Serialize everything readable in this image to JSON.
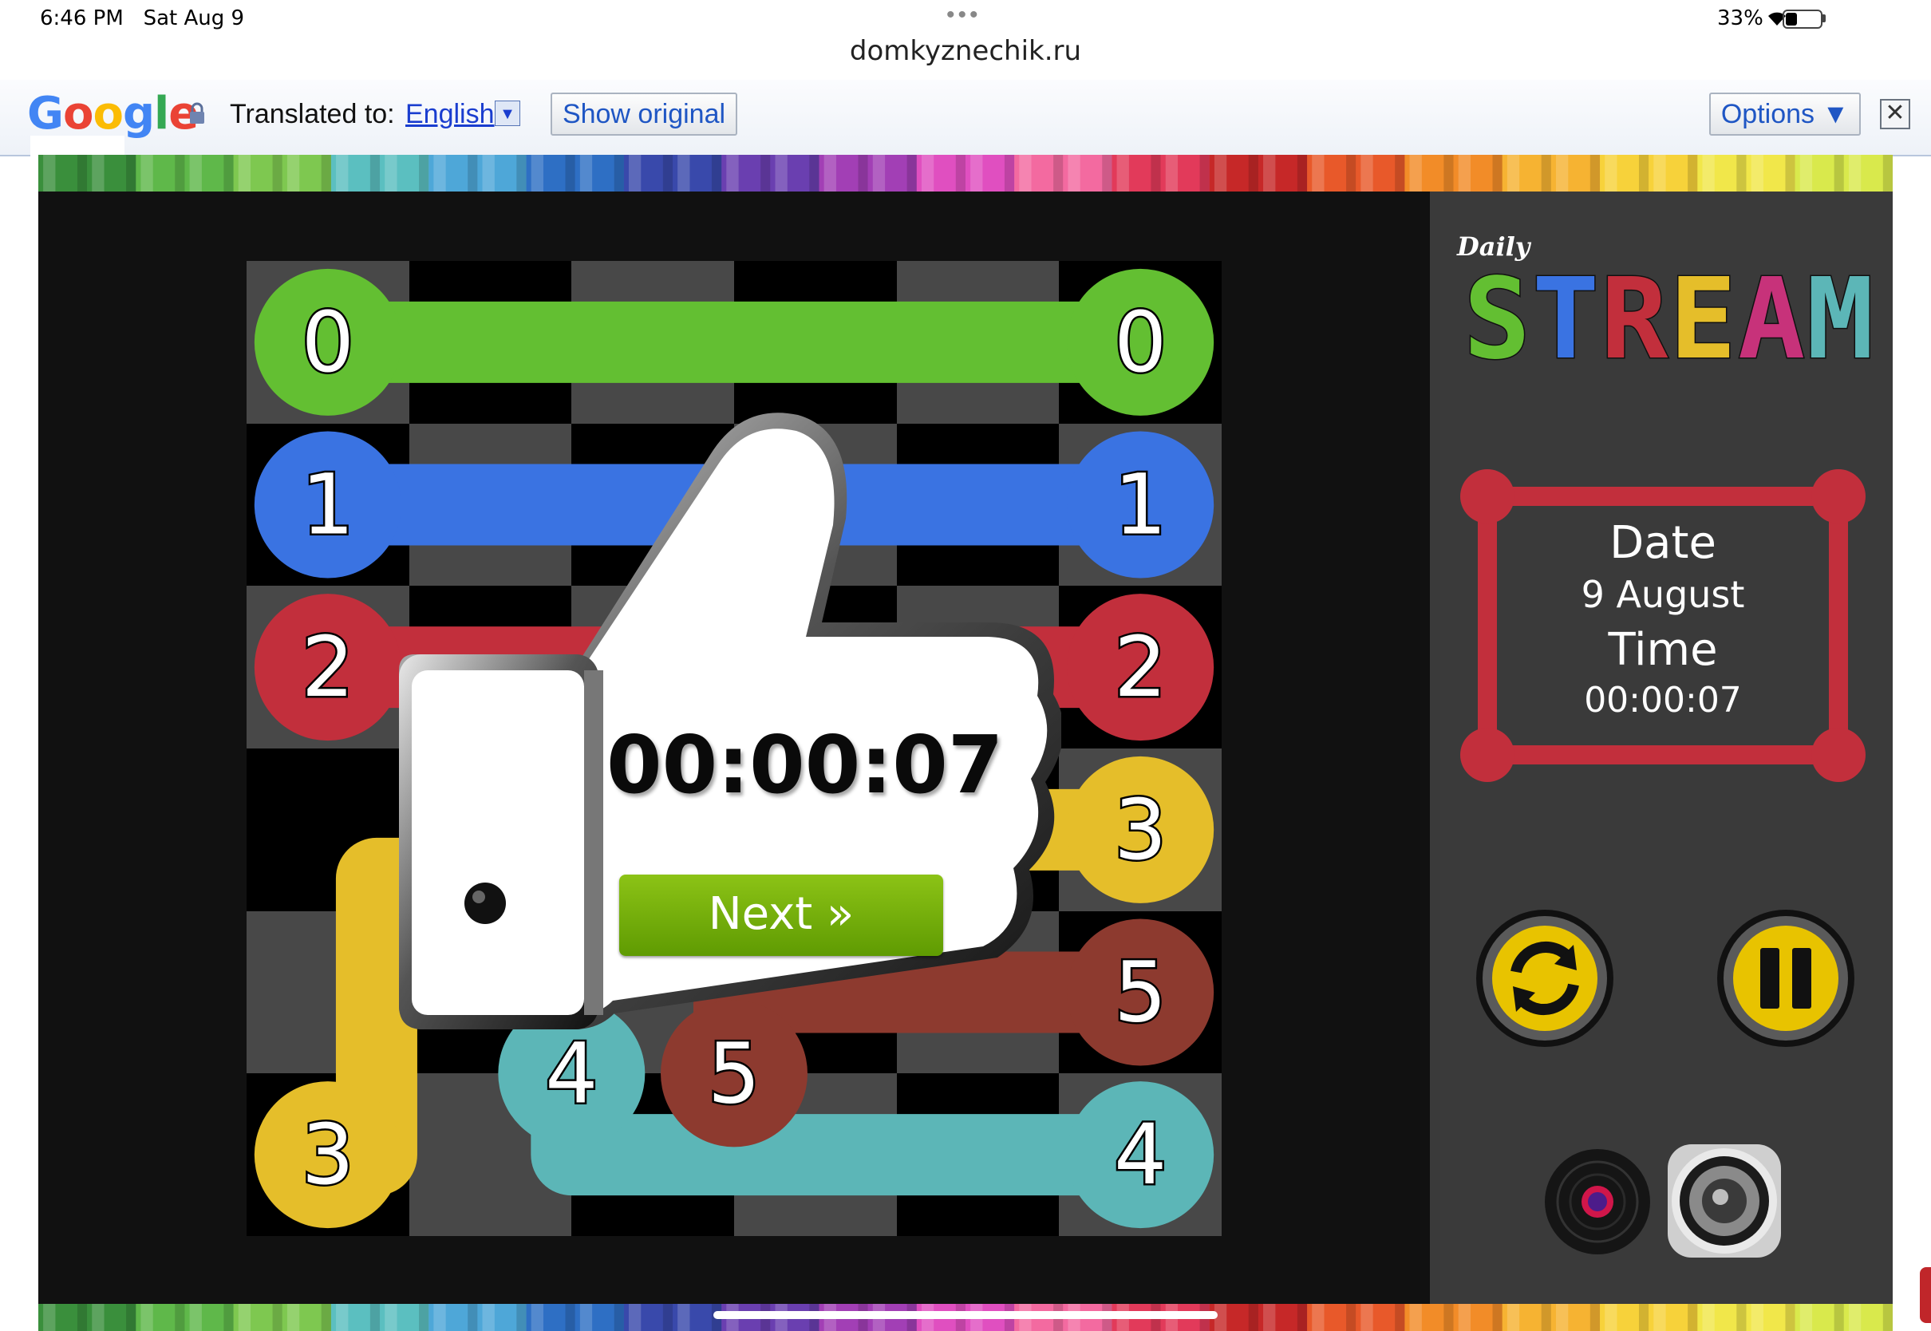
{
  "status_bar": {
    "time": "6:46 PM",
    "date": "Sat Aug 9",
    "battery_pct": "33%",
    "battery_level": 0.33,
    "url": "domkyznechik.ru"
  },
  "translate_bar": {
    "logo": "Google",
    "translated_to_label": "Translated to:",
    "language": "English",
    "dropdown_glyph": "▼",
    "show_original": "Show original",
    "options": "Options ▼",
    "close_glyph": "✕"
  },
  "board": {
    "rows": 6,
    "cols": 6,
    "light_cell_color": "#484848",
    "dark_cell_color": "#000000",
    "flows": [
      {
        "number": "0",
        "color": "#63bf32"
      },
      {
        "number": "1",
        "color": "#3a73e2"
      },
      {
        "number": "2",
        "color": "#c22f3c"
      },
      {
        "number": "3",
        "color": "#e5be2a"
      },
      {
        "number": "4",
        "color": "#5cb6b7"
      },
      {
        "number": "5",
        "color": "#8d3a2f"
      }
    ]
  },
  "sidebar": {
    "logo_small": "Daily",
    "logo_big": "STREAM",
    "logo_letter_colors": [
      "#63bf32",
      "#3a73e2",
      "#c22f3c",
      "#e5be2a",
      "#c7327a",
      "#5cb6b7"
    ],
    "date_label": "Date",
    "date_value": "9 August",
    "time_label": "Time",
    "time_value": "00:00:07",
    "frame_color": "#c22f3c",
    "button_color": "#e8c300",
    "icons": [
      "refresh-icon",
      "pause-icon",
      "music-disc-icon",
      "speaker-icon"
    ]
  },
  "popup": {
    "time": "00:00:07",
    "next_label": "Next »",
    "next_color": "#7ab30d"
  }
}
